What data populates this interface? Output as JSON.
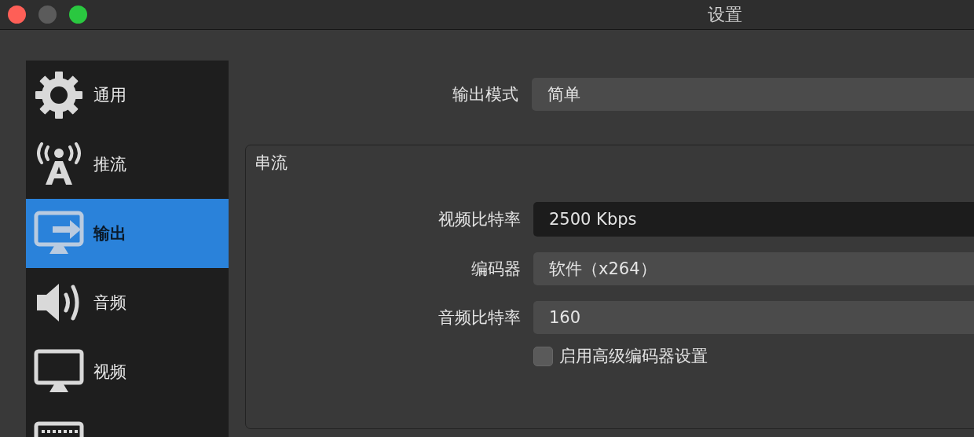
{
  "window": {
    "title": "设置"
  },
  "sidebar": {
    "items": [
      {
        "label": "通用",
        "selected": false
      },
      {
        "label": "推流",
        "selected": false
      },
      {
        "label": "输出",
        "selected": true
      },
      {
        "label": "音频",
        "selected": false
      },
      {
        "label": "视频",
        "selected": false
      },
      {
        "selected": false
      }
    ]
  },
  "output_mode": {
    "label": "输出模式",
    "value": "简单"
  },
  "group": {
    "title": "串流",
    "rows": [
      {
        "kind": "input",
        "label": "视频比特率",
        "value": "2500 Kbps"
      },
      {
        "kind": "select",
        "label": "编码器",
        "value": "软件（x264）"
      },
      {
        "kind": "select",
        "label": "音频比特率",
        "value": "160"
      }
    ],
    "checkbox": {
      "label": "启用高级编码器设置",
      "checked": false
    }
  }
}
